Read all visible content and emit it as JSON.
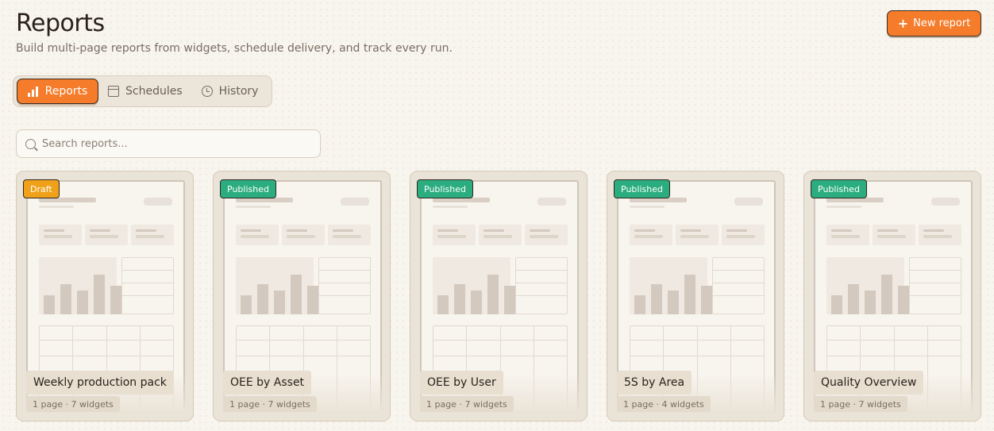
{
  "header": {
    "title": "Reports",
    "subtitle": "Build multi-page reports from widgets, schedule delivery, and track every run.",
    "new_report_label": "New report"
  },
  "tabs": [
    {
      "label": "Reports",
      "icon": "bar-chart-icon",
      "active": true
    },
    {
      "label": "Schedules",
      "icon": "calendar-icon",
      "active": false
    },
    {
      "label": "History",
      "icon": "history-icon",
      "active": false
    }
  ],
  "search": {
    "placeholder": "Search reports...",
    "value": ""
  },
  "reports": [
    {
      "status": "Draft",
      "title": "Weekly production pack",
      "meta": "1 page · 7 widgets"
    },
    {
      "status": "Published",
      "title": "OEE by Asset",
      "meta": "1 page · 7 widgets"
    },
    {
      "status": "Published",
      "title": "OEE by User",
      "meta": "1 page · 7 widgets"
    },
    {
      "status": "Published",
      "title": "5S by Area",
      "meta": "1 page · 4 widgets"
    },
    {
      "status": "Published",
      "title": "Quality Overview",
      "meta": "1 page · 7 widgets"
    }
  ],
  "colors": {
    "accent": "#f47c2a",
    "draft": "#f0a11a",
    "published": "#2bad80",
    "background": "#f8f5ef"
  }
}
